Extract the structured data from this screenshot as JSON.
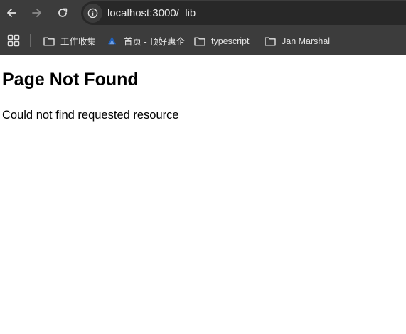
{
  "browser": {
    "nav": {
      "back_icon": "arrow-left-icon",
      "forward_icon": "arrow-right-icon",
      "reload_icon": "reload-icon"
    },
    "address_bar": {
      "icon": "info-icon",
      "url": "localhost:3000/_lib"
    },
    "bookmarks": [
      {
        "label": "工作收集",
        "icon": "folder-icon"
      },
      {
        "label": "首页 - 顶好惠企",
        "icon": "site-favicon"
      },
      {
        "label": "typescript",
        "icon": "folder-icon"
      },
      {
        "label": "Jan Marshal",
        "icon": "folder-icon"
      }
    ],
    "colors": {
      "chrome_bg": "#3c3c3c",
      "omnibox_bg": "#282828",
      "chrome_text": "#e3e3e3"
    }
  },
  "page": {
    "title": "Page Not Found",
    "message": "Could not find requested resource"
  }
}
